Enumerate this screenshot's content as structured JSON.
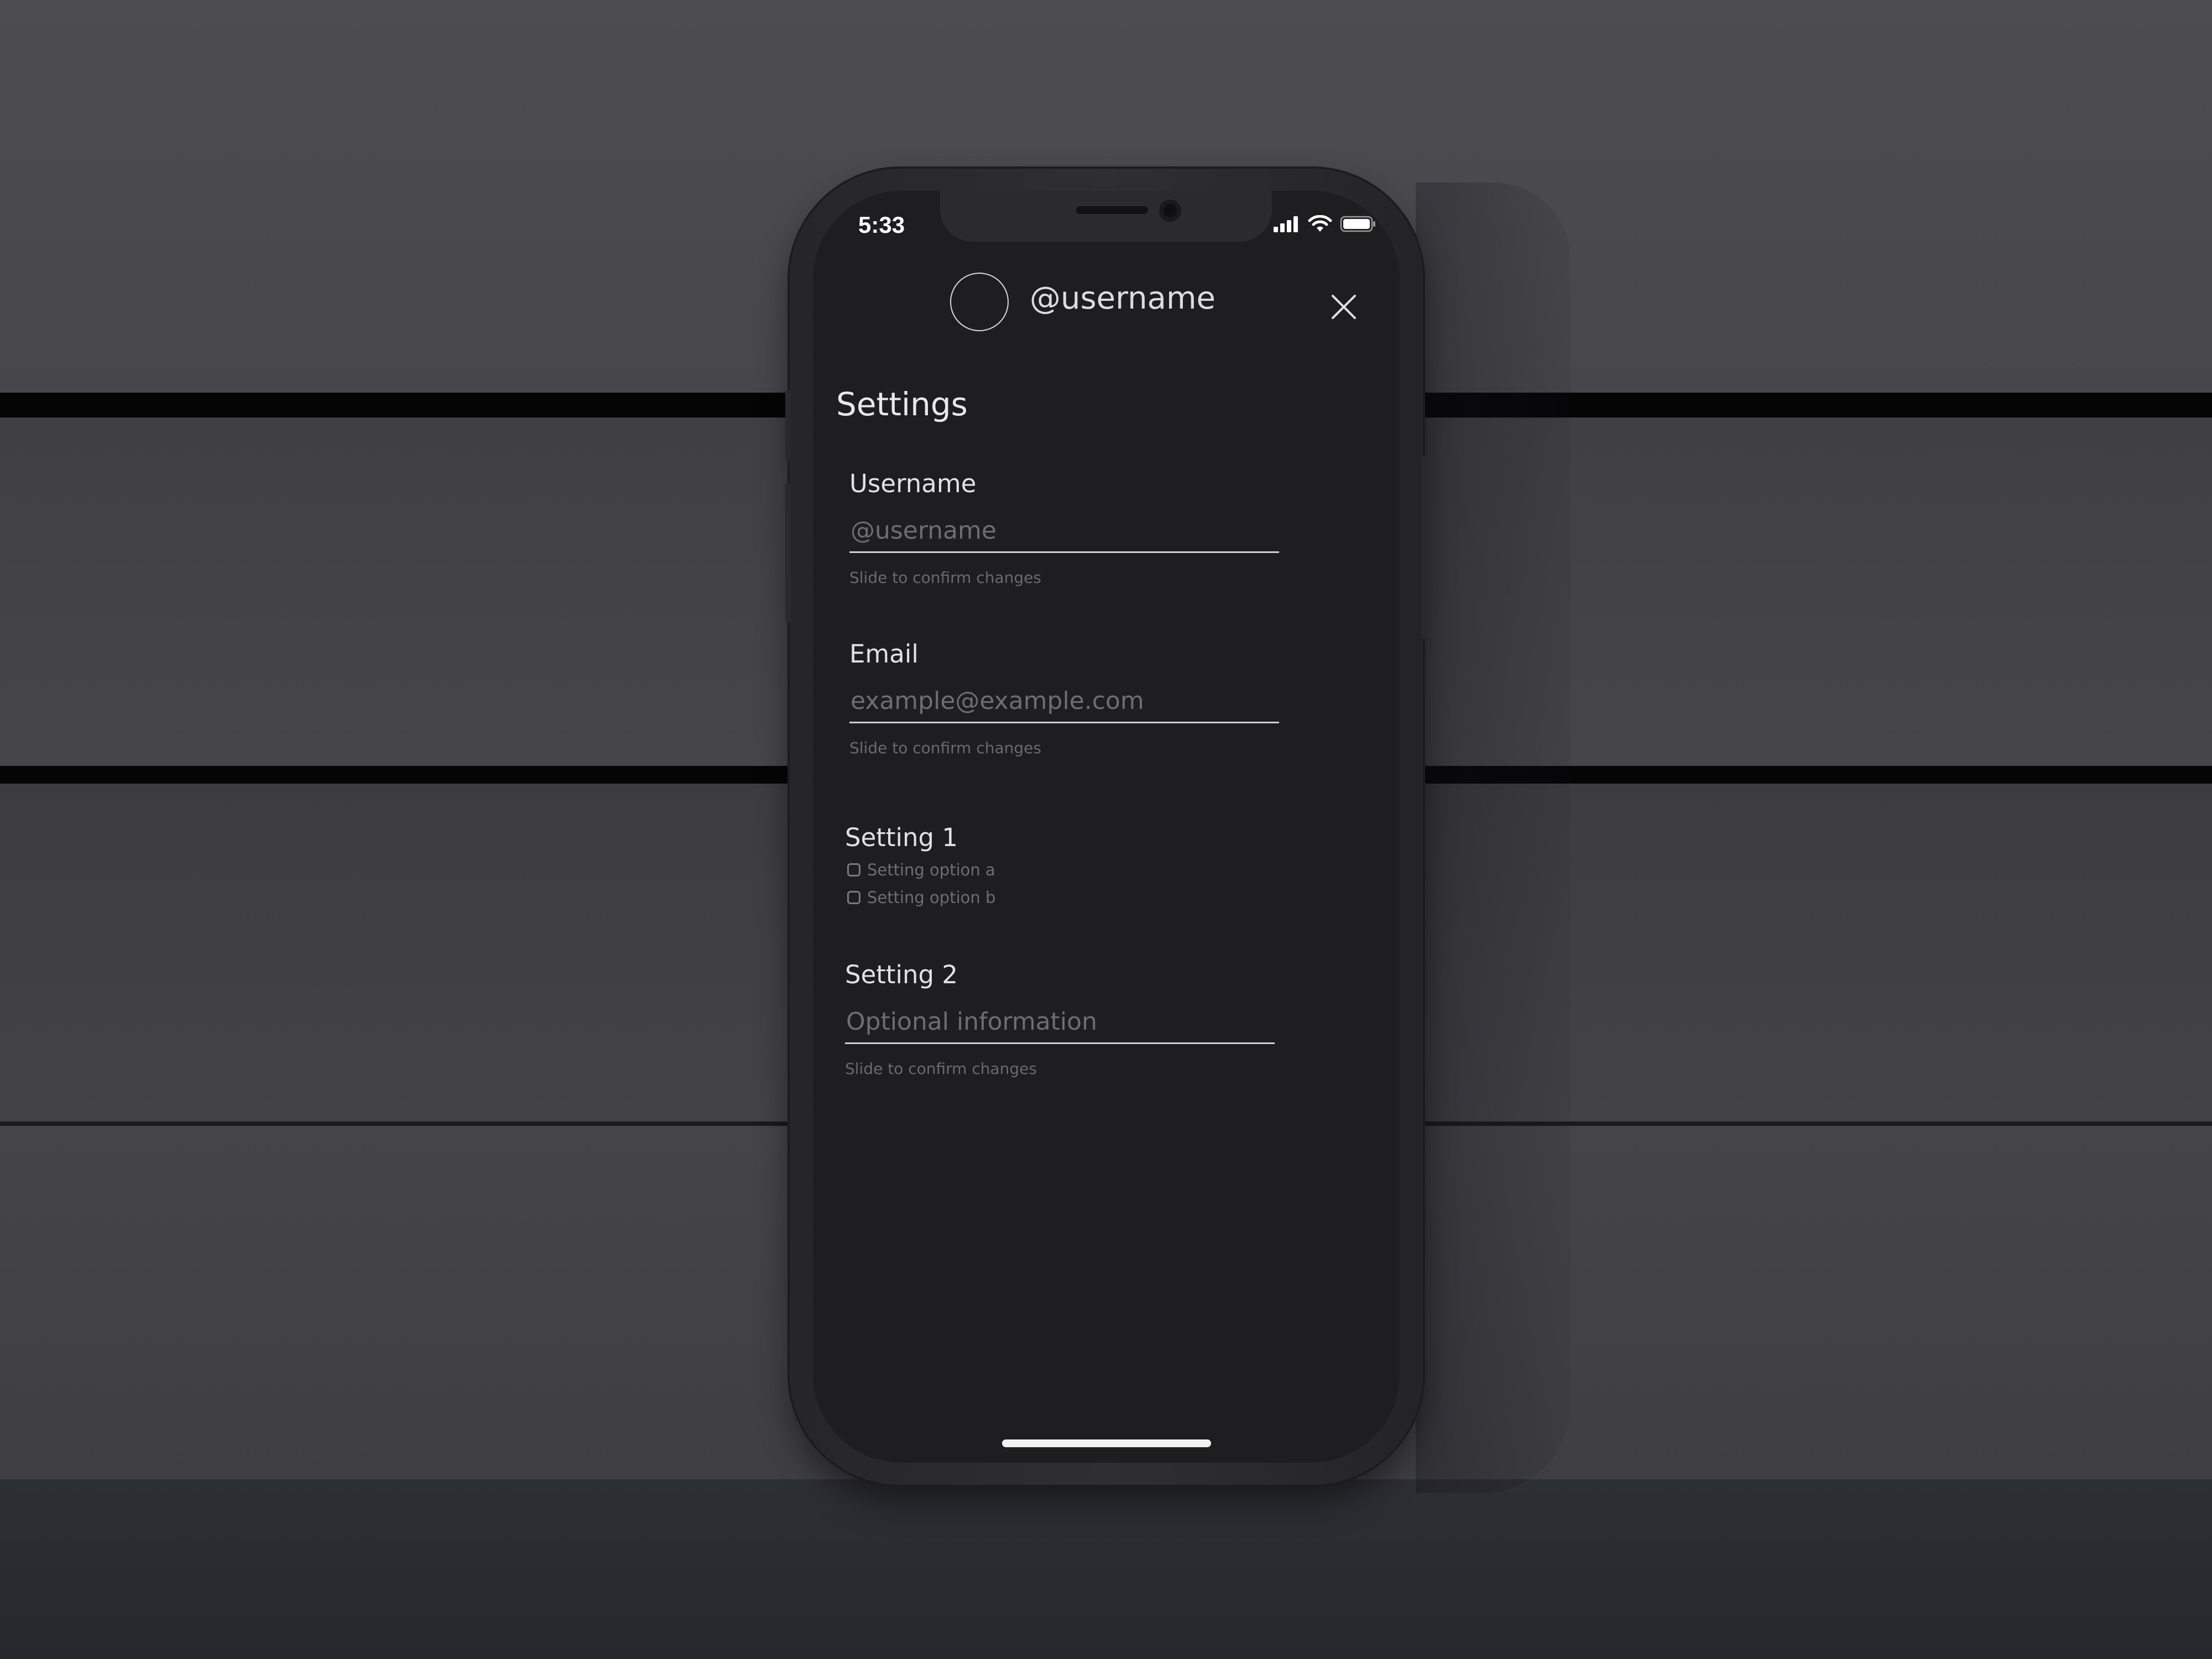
{
  "status_bar": {
    "time": "5:33",
    "icons": [
      "signal-icon",
      "wifi-icon",
      "battery-icon"
    ]
  },
  "header": {
    "username": "@username",
    "close_icon": "close-icon"
  },
  "settings": {
    "title": "Settings",
    "username_field": {
      "label": "Username",
      "placeholder": "@username",
      "hint": "Slide to confirm changes"
    },
    "email_field": {
      "label": "Email",
      "placeholder": "example@example.com",
      "hint": "Slide to confirm changes"
    },
    "setting1": {
      "label": "Setting 1",
      "options": [
        {
          "label": "Setting option a",
          "checked": false
        },
        {
          "label": "Setting option b",
          "checked": false
        }
      ]
    },
    "setting2": {
      "label": "Setting 2",
      "placeholder": "Optional information",
      "hint": "Slide to confirm changes"
    }
  },
  "colors": {
    "screen_background": "#1e1e20",
    "text_primary": "#e2e2e2",
    "text_muted": "#6e6e72",
    "underline": "#cfcfcf"
  }
}
